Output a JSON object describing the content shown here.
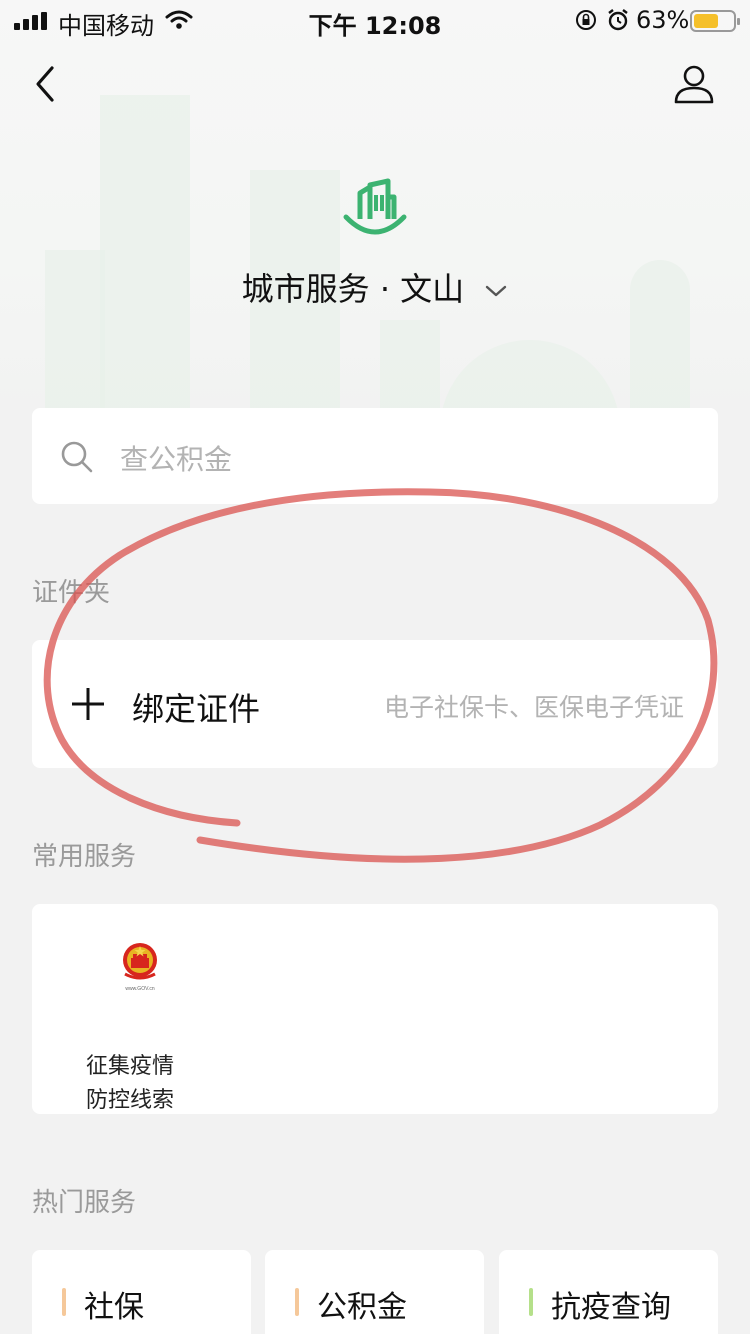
{
  "status_bar": {
    "carrier": "中国移动",
    "time": "下午 12:08",
    "battery_percent": "63%",
    "battery_level": 0.63,
    "battery_color": "#f5c02a"
  },
  "nav": {
    "back_icon": "back-chevron-icon",
    "profile_icon": "user-icon"
  },
  "header": {
    "logo_icon": "city-building-icon",
    "title": "城市服务 · 文山",
    "accent_color": "#3cb371"
  },
  "search": {
    "placeholder": "查公积金"
  },
  "certificates": {
    "section_label": "证件夹",
    "bind_label": "绑定证件",
    "bind_hint": "电子社保卡、医保电子凭证"
  },
  "common_services": {
    "section_label": "常用服务",
    "items": [
      {
        "label": "征集疫情\n防控线索",
        "icon": "national-emblem-icon"
      }
    ]
  },
  "hot_services": {
    "section_label": "热门服务",
    "items": [
      {
        "label": "社保",
        "bar_color": "#f5c89a"
      },
      {
        "label": "公积金",
        "bar_color": "#f5c89a"
      },
      {
        "label": "抗疫查询",
        "bar_color": "#b5e08a"
      }
    ]
  },
  "annotation_color": "#d9534f"
}
